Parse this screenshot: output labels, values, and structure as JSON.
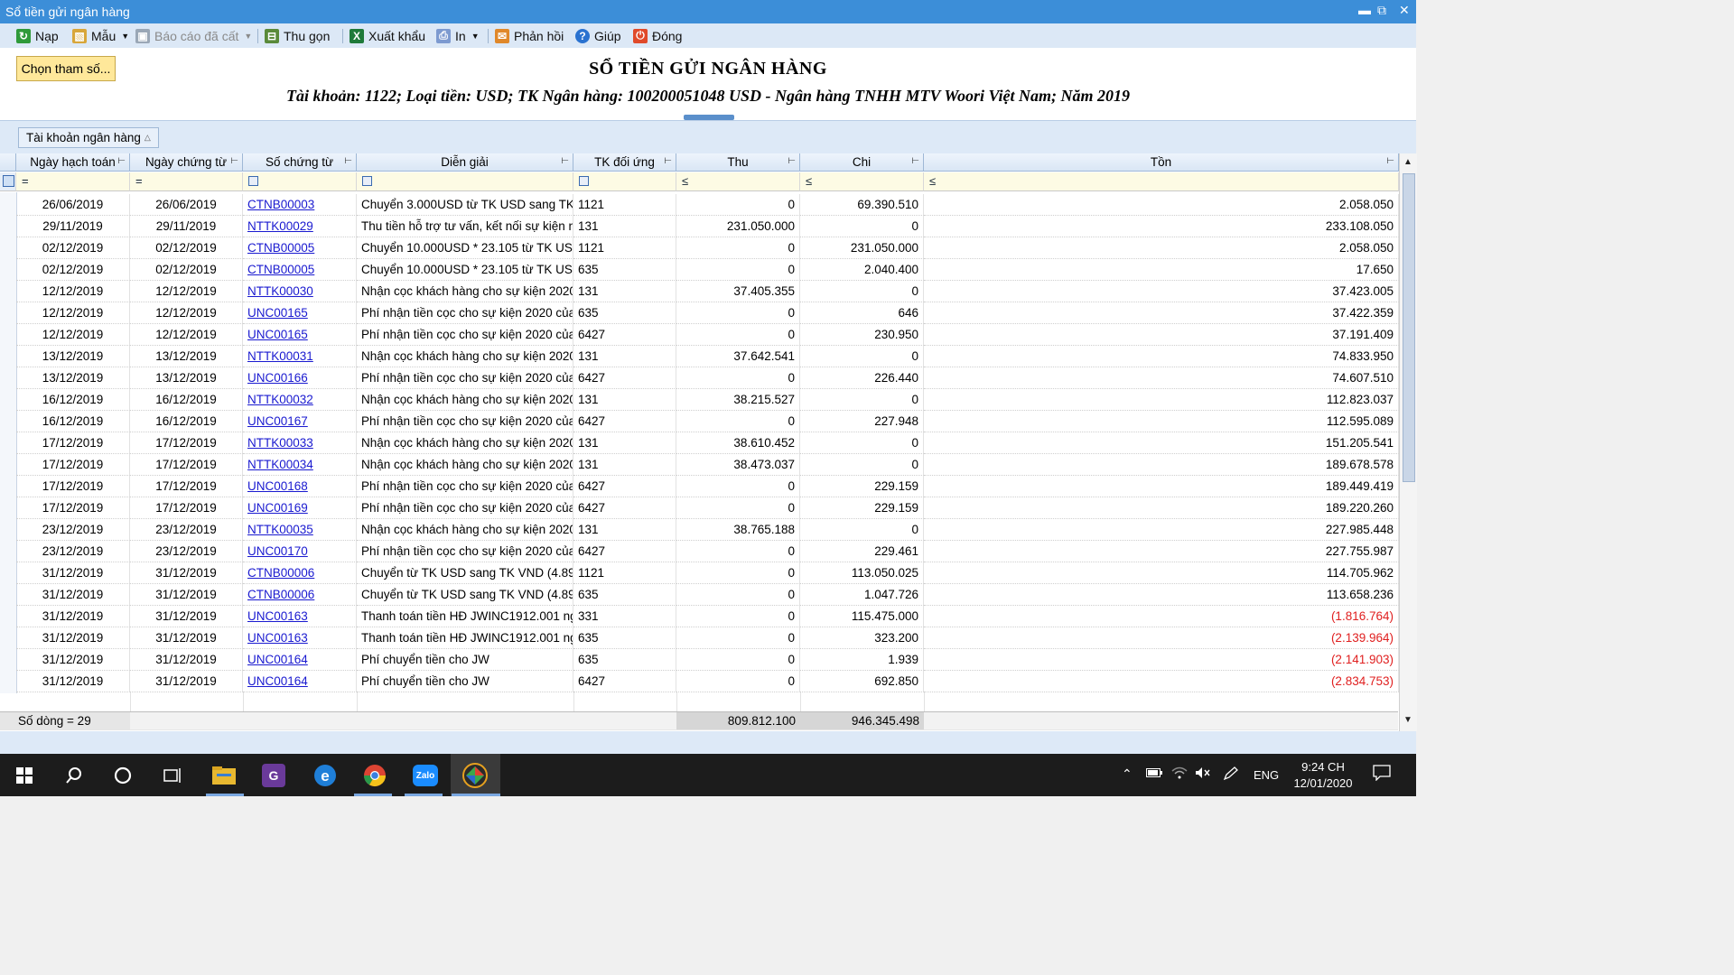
{
  "window": {
    "title": "Sổ tiền gửi ngân hàng",
    "controls": [
      "minimize-icon",
      "restore-icon",
      "close-icon"
    ]
  },
  "toolbar": {
    "nap": "Nạp",
    "mau": "Mẫu",
    "bao_cao": "Báo cáo đã cất",
    "thu_gon": "Thu gọn",
    "xuat_khau": "Xuất khẩu",
    "in": "In",
    "phan_hoi": "Phản hồi",
    "giup": "Giúp",
    "dong": "Đóng"
  },
  "report": {
    "button_chon": "Chọn tham số...",
    "title": "SỔ TIỀN GỬI NGÂN HÀNG",
    "subtitle": "Tài khoản: 1122; Loại tiền: USD; TK Ngân hàng: 100200051048 USD - Ngân hàng TNHH MTV Woori Việt Nam; Năm 2019"
  },
  "group_panel": {
    "chip": "Tài khoản ngân hàng"
  },
  "columns": {
    "ngay_hach_toan": "Ngày hạch toán",
    "ngay_chung_tu": "Ngày chứng từ",
    "so_chung_tu": "Số chứng từ",
    "dien_giai": "Diễn giải",
    "tk_doi_ung": "TK đối ứng",
    "thu": "Thu",
    "chi": "Chi",
    "ton": "Tồn"
  },
  "filter_ops": {
    "eq": "=",
    "le": "≤"
  },
  "rows": [
    {
      "nht": "26/06/2019",
      "nct": "26/06/2019",
      "sct": "CTNB00003",
      "dg": "Chuyển 3.000USD từ TK USD sang TK",
      "tk": "1121",
      "thu": "0",
      "chi": "69.390.510",
      "ton": "2.058.050",
      "neg": false
    },
    {
      "nht": "29/11/2019",
      "nct": "29/11/2019",
      "sct": "NTTK00029",
      "dg": "Thu tiền hỗ trợ tư vấn, kết nối sự kiện ng",
      "tk": "131",
      "thu": "231.050.000",
      "chi": "0",
      "ton": "233.108.050",
      "neg": false
    },
    {
      "nht": "02/12/2019",
      "nct": "02/12/2019",
      "sct": "CTNB00005",
      "dg": "Chuyển 10.000USD * 23.105 từ TK US",
      "tk": "1121",
      "thu": "0",
      "chi": "231.050.000",
      "ton": "2.058.050",
      "neg": false
    },
    {
      "nht": "02/12/2019",
      "nct": "02/12/2019",
      "sct": "CTNB00005",
      "dg": "Chuyển 10.000USD * 23.105 từ TK US",
      "tk": "635",
      "thu": "0",
      "chi": "2.040.400",
      "ton": "17.650",
      "neg": false
    },
    {
      "nht": "12/12/2019",
      "nct": "12/12/2019",
      "sct": "NTTK00030",
      "dg": "Nhận cọc khách hàng cho sự kiện 2020",
      "tk": "131",
      "thu": "37.405.355",
      "chi": "0",
      "ton": "37.423.005",
      "neg": false
    },
    {
      "nht": "12/12/2019",
      "nct": "12/12/2019",
      "sct": "UNC00165",
      "dg": "Phí nhận tiền cọc cho sự kiện 2020 của",
      "tk": "635",
      "thu": "0",
      "chi": "646",
      "ton": "37.422.359",
      "neg": false
    },
    {
      "nht": "12/12/2019",
      "nct": "12/12/2019",
      "sct": "UNC00165",
      "dg": "Phí nhận tiền cọc cho sự kiện 2020 của",
      "tk": "6427",
      "thu": "0",
      "chi": "230.950",
      "ton": "37.191.409",
      "neg": false
    },
    {
      "nht": "13/12/2019",
      "nct": "13/12/2019",
      "sct": "NTTK00031",
      "dg": "Nhận cọc khách hàng cho sự kiện 2020",
      "tk": "131",
      "thu": "37.642.541",
      "chi": "0",
      "ton": "74.833.950",
      "neg": false
    },
    {
      "nht": "13/12/2019",
      "nct": "13/12/2019",
      "sct": "UNC00166",
      "dg": "Phí nhận tiền cọc cho sự kiện 2020 của",
      "tk": "6427",
      "thu": "0",
      "chi": "226.440",
      "ton": "74.607.510",
      "neg": false
    },
    {
      "nht": "16/12/2019",
      "nct": "16/12/2019",
      "sct": "NTTK00032",
      "dg": "Nhận cọc khách hàng cho sự kiện 2020",
      "tk": "131",
      "thu": "38.215.527",
      "chi": "0",
      "ton": "112.823.037",
      "neg": false
    },
    {
      "nht": "16/12/2019",
      "nct": "16/12/2019",
      "sct": "UNC00167",
      "dg": "Phí nhận tiền cọc cho sự kiện 2020 của",
      "tk": "6427",
      "thu": "0",
      "chi": "227.948",
      "ton": "112.595.089",
      "neg": false
    },
    {
      "nht": "17/12/2019",
      "nct": "17/12/2019",
      "sct": "NTTK00033",
      "dg": "Nhận cọc khách hàng cho sự kiện 2020",
      "tk": "131",
      "thu": "38.610.452",
      "chi": "0",
      "ton": "151.205.541",
      "neg": false
    },
    {
      "nht": "17/12/2019",
      "nct": "17/12/2019",
      "sct": "NTTK00034",
      "dg": "Nhận cọc khách hàng cho sự kiện 2020",
      "tk": "131",
      "thu": "38.473.037",
      "chi": "0",
      "ton": "189.678.578",
      "neg": false
    },
    {
      "nht": "17/12/2019",
      "nct": "17/12/2019",
      "sct": "UNC00168",
      "dg": "Phí nhận tiền cọc cho sự kiện 2020 của",
      "tk": "6427",
      "thu": "0",
      "chi": "229.159",
      "ton": "189.449.419",
      "neg": false
    },
    {
      "nht": "17/12/2019",
      "nct": "17/12/2019",
      "sct": "UNC00169",
      "dg": "Phí nhận tiền cọc cho sự kiện 2020 của",
      "tk": "6427",
      "thu": "0",
      "chi": "229.159",
      "ton": "189.220.260",
      "neg": false
    },
    {
      "nht": "23/12/2019",
      "nct": "23/12/2019",
      "sct": "NTTK00035",
      "dg": "Nhận cọc khách hàng cho sự kiện 2020",
      "tk": "131",
      "thu": "38.765.188",
      "chi": "0",
      "ton": "227.985.448",
      "neg": false
    },
    {
      "nht": "23/12/2019",
      "nct": "23/12/2019",
      "sct": "UNC00170",
      "dg": "Phí nhận tiền cọc cho sự kiện 2020 của",
      "tk": "6427",
      "thu": "0",
      "chi": "229.461",
      "ton": "227.755.987",
      "neg": false
    },
    {
      "nht": "31/12/2019",
      "nct": "31/12/2019",
      "sct": "CTNB00006",
      "dg": "Chuyển từ TK USD sang TK VND (4.89",
      "tk": "1121",
      "thu": "0",
      "chi": "113.050.025",
      "ton": "114.705.962",
      "neg": false
    },
    {
      "nht": "31/12/2019",
      "nct": "31/12/2019",
      "sct": "CTNB00006",
      "dg": "Chuyển từ TK USD sang TK VND (4.89",
      "tk": "635",
      "thu": "0",
      "chi": "1.047.726",
      "ton": "113.658.236",
      "neg": false
    },
    {
      "nht": "31/12/2019",
      "nct": "31/12/2019",
      "sct": "UNC00163",
      "dg": "Thanh toán tiền HĐ JWINC1912.001 ng",
      "tk": "331",
      "thu": "0",
      "chi": "115.475.000",
      "ton": "(1.816.764)",
      "neg": true
    },
    {
      "nht": "31/12/2019",
      "nct": "31/12/2019",
      "sct": "UNC00163",
      "dg": "Thanh toán tiền HĐ JWINC1912.001 ng",
      "tk": "635",
      "thu": "0",
      "chi": "323.200",
      "ton": "(2.139.964)",
      "neg": true
    },
    {
      "nht": "31/12/2019",
      "nct": "31/12/2019",
      "sct": "UNC00164",
      "dg": "Phí chuyển tiền cho JW",
      "tk": "635",
      "thu": "0",
      "chi": "1.939",
      "ton": "(2.141.903)",
      "neg": true
    },
    {
      "nht": "31/12/2019",
      "nct": "31/12/2019",
      "sct": "UNC00164",
      "dg": "Phí chuyển tiền cho JW",
      "tk": "6427",
      "thu": "0",
      "chi": "692.850",
      "ton": "(2.834.753)",
      "neg": true
    }
  ],
  "footer": {
    "row_count": "Số dòng = 29",
    "total_thu": "809.812.100",
    "total_chi": "946.345.498"
  },
  "colors": {
    "negative": "#e02020",
    "link": "#1a1ad0",
    "titlebar": "#3c8ed8",
    "filter_row": "#fdfbe4"
  },
  "taskbar": {
    "icons": [
      "windows-start-icon",
      "search-icon",
      "cortana-icon",
      "task-view-icon",
      "file-explorer-icon",
      "pdf-app-icon",
      "edge-icon",
      "chrome-icon",
      "zalo-icon",
      "misa-app-icon"
    ],
    "zalo_label": "Zalo",
    "language": "ENG",
    "time": "9:24 CH",
    "date": "12/01/2020"
  }
}
